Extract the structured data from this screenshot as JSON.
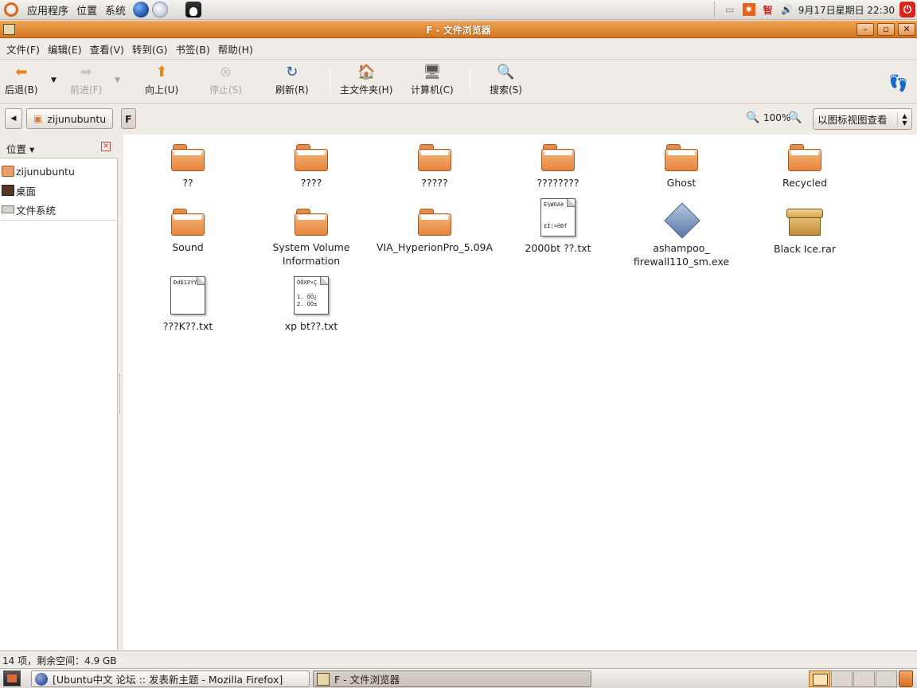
{
  "top_panel": {
    "menus": [
      "应用程序",
      "位置",
      "系统"
    ],
    "launchers": [
      "firefox-globe-icon",
      "mail-icon",
      "tux-icon"
    ],
    "clock": "9月17日星期日 22:30"
  },
  "window": {
    "title": "F - 文件浏览器"
  },
  "menubar": [
    "文件(F)",
    "编辑(E)",
    "查看(V)",
    "转到(G)",
    "书签(B)",
    "帮助(H)"
  ],
  "toolbar": {
    "back": "后退(B)",
    "forward": "前进(F)",
    "up": "向上(U)",
    "stop": "停止(S)",
    "reload": "刷新(R)",
    "home": "主文件夹(H)",
    "computer": "计算机(C)",
    "search": "搜索(S)"
  },
  "location": {
    "crumbs": [
      "zijunubuntu",
      "F"
    ],
    "zoom": "100%",
    "view_mode": "以图标视图查看"
  },
  "sidebar": {
    "title": "位置",
    "items": [
      "zijunubuntu",
      "桌面",
      "文件系统"
    ]
  },
  "files": [
    {
      "name": "??",
      "type": "folder"
    },
    {
      "name": "????",
      "type": "folder"
    },
    {
      "name": "?????",
      "type": "folder"
    },
    {
      "name": "????????",
      "type": "folder"
    },
    {
      "name": "Ghost",
      "type": "folder"
    },
    {
      "name": "Recycled",
      "type": "folder"
    },
    {
      "name": "Sound",
      "type": "folder"
    },
    {
      "name": "System Volume Information",
      "type": "folder"
    },
    {
      "name": "VIA_HyperionPro_5.09A",
      "type": "folder"
    },
    {
      "name": "2000bt ??.txt",
      "type": "text",
      "preview": [
        "E½WOÁè",
        "",
        "",
        "£Ï¦¤ëÐf"
      ]
    },
    {
      "name": "ashampoo_firewall110_sm.exe",
      "type": "exe"
    },
    {
      "name": "Black Ice.rar",
      "type": "archive"
    },
    {
      "name": "???K??.txt",
      "type": "text",
      "preview": [
        "Ðdß13ÝÝ"
      ]
    },
    {
      "name": "xp bt??.txt",
      "type": "text",
      "preview": [
        "ÖÕXP×Ç",
        "",
        "1. ÖÖ¿",
        "2. ÖÖ±"
      ]
    }
  ],
  "status": "14 项，剩余空间：4.9 GB",
  "taskbar": {
    "tasks": [
      "[Ubuntu中文 论坛 :: 发表新主题 - Mozilla Firefox]",
      "F - 文件浏览器"
    ]
  },
  "colors": {
    "title_orange": "#d5761f",
    "folder_orange": "#e6853c"
  }
}
